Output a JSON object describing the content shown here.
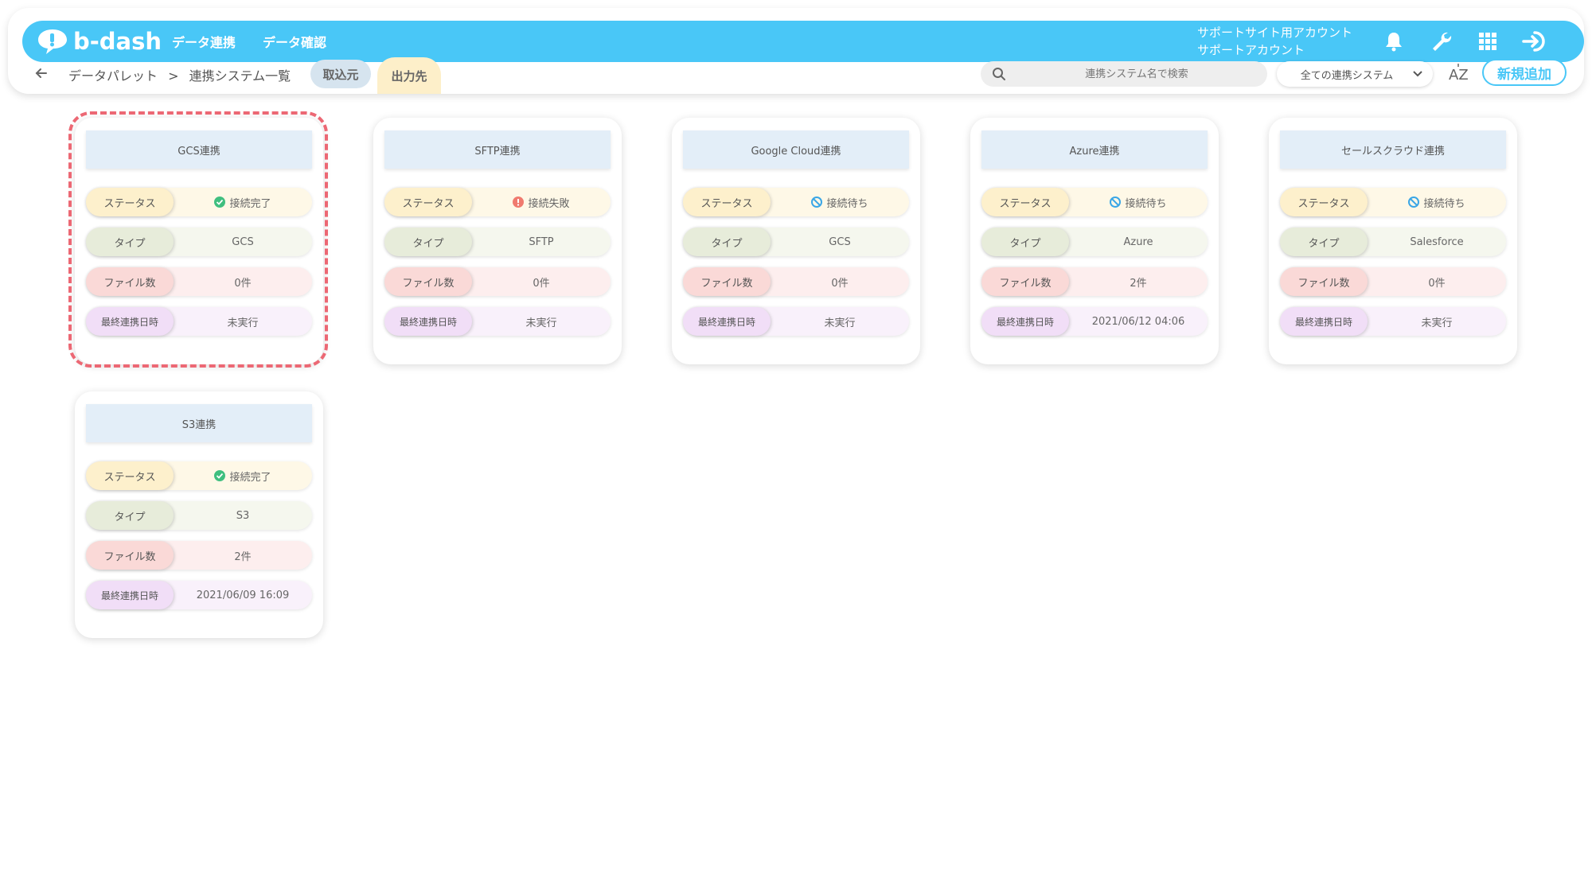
{
  "header": {
    "logo_text": "b-dash",
    "nav": [
      "データ連携",
      "データ確認"
    ],
    "account_line1": "サポートサイト用アカウント",
    "account_line2": "サポートアカウント",
    "accent_color": "#49c7f7"
  },
  "subbar": {
    "breadcrumb_root": "データパレット",
    "breadcrumb_sep": ">",
    "breadcrumb_current": "連携システム一覧",
    "tab_import": "取込元",
    "tab_export": "出力先",
    "search_placeholder": "連携システム名で検索",
    "filter_selected": "全ての連携システム",
    "sort_label": "AZ",
    "add_button": "新規追加"
  },
  "labels": {
    "status": "ステータス",
    "type": "タイプ",
    "files": "ファイル数",
    "last_run": "最終連携日時"
  },
  "cards": [
    {
      "title": "GCS連携",
      "status": "接続完了",
      "status_kind": "ok",
      "type": "GCS",
      "files": "0件",
      "last_run": "未実行"
    },
    {
      "title": "SFTP連携",
      "status": "接続失敗",
      "status_kind": "fail",
      "type": "SFTP",
      "files": "0件",
      "last_run": "未実行"
    },
    {
      "title": "Google Cloud連携",
      "status": "接続待ち",
      "status_kind": "wait",
      "type": "GCS",
      "files": "0件",
      "last_run": "未実行"
    },
    {
      "title": "Azure連携",
      "status": "接続待ち",
      "status_kind": "wait",
      "type": "Azure",
      "files": "2件",
      "last_run": "2021/06/12 04:06"
    },
    {
      "title": "セールスクラウド連携",
      "status": "接続待ち",
      "status_kind": "wait",
      "type": "Salesforce",
      "files": "0件",
      "last_run": "未実行"
    },
    {
      "title": "S3連携",
      "status": "接続完了",
      "status_kind": "ok",
      "type": "S3",
      "files": "2件",
      "last_run": "2021/06/09 16:09"
    }
  ]
}
